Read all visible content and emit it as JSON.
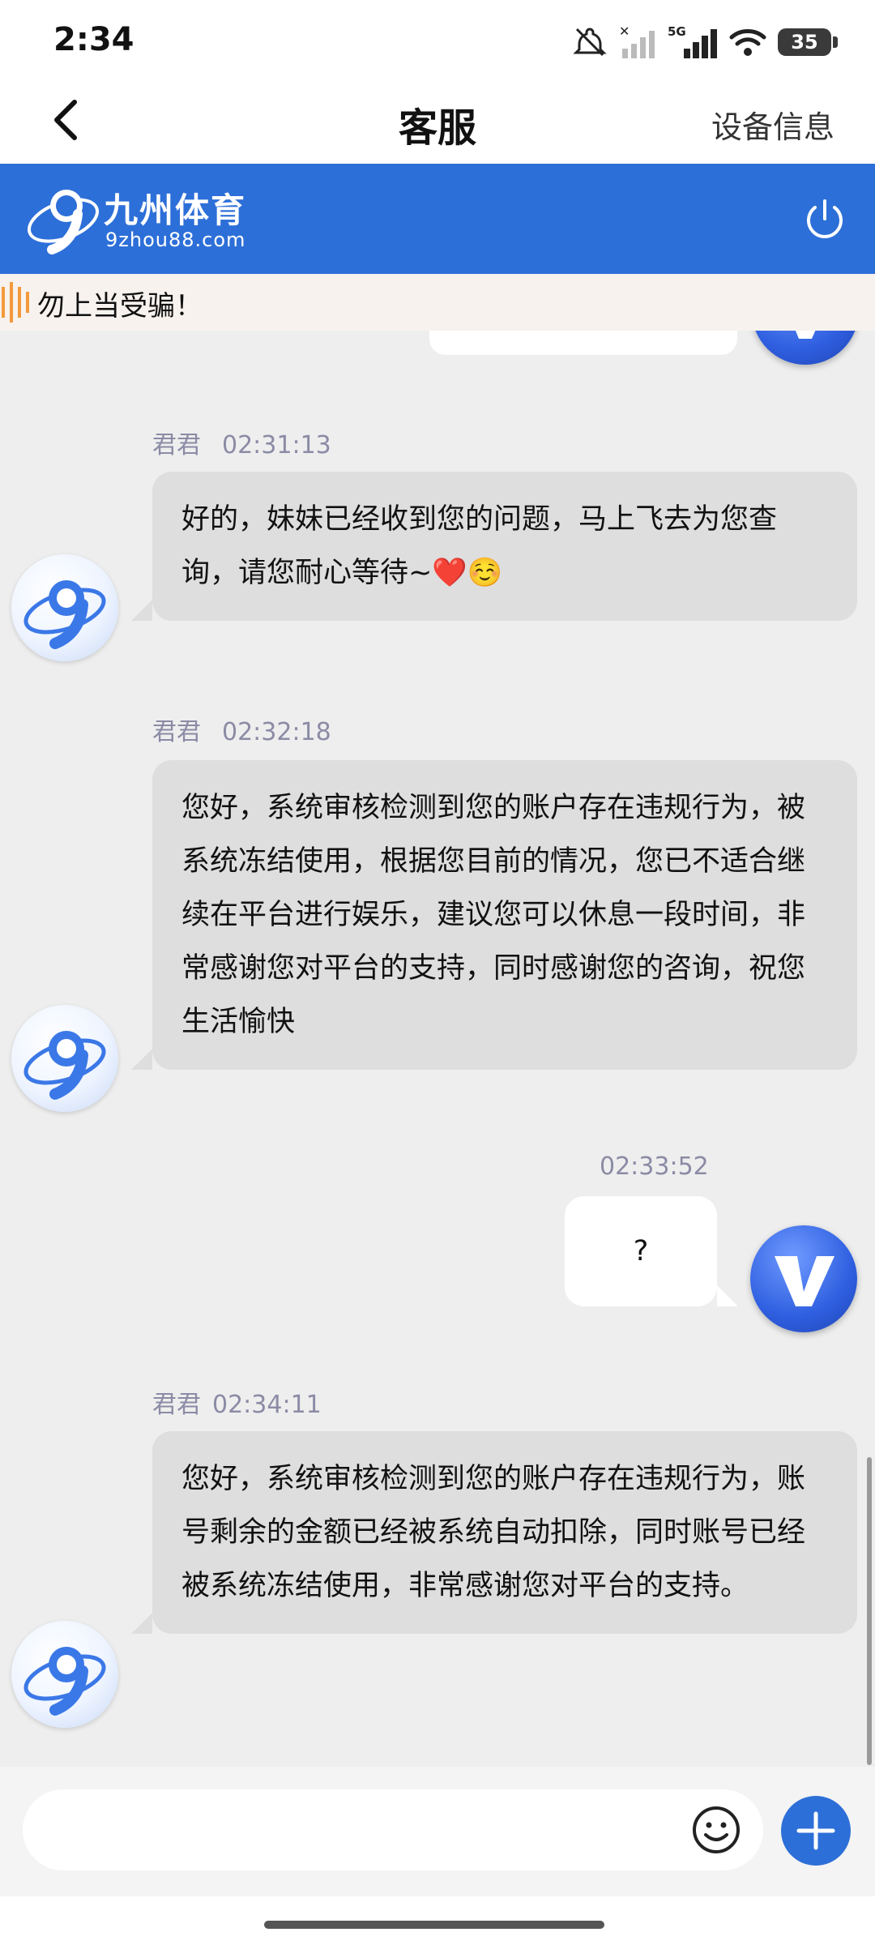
{
  "status_bar": {
    "time": "2:34",
    "network": "5G",
    "battery": "35"
  },
  "title_bar": {
    "title": "客服",
    "right_action": "设备信息"
  },
  "brand": {
    "name": "九州体育",
    "domain": "9zhou88.com",
    "color": "#2d6fd8"
  },
  "notice": {
    "text": "勿上当受骗！"
  },
  "messages": [
    {
      "sender": "君君",
      "time": "02:31:13",
      "text": "好的，妹妹已经收到您的问题，马上飞去为您查询，请您耐心等待~❤️☺️"
    },
    {
      "sender": "君君",
      "time": "02:32:18",
      "text": "您好，系统审核检测到您的账户存在违规行为，被系统冻结使用，根据您目前的情况，您已不适合继续在平台进行娱乐，建议您可以休息一段时间，非常感谢您对平台的支持，同时感谢您的咨询，祝您生活愉快"
    },
    {
      "sender": "",
      "time": "02:33:52",
      "text": "?"
    },
    {
      "sender": "君君",
      "time": "02:34:11",
      "text": "您好，系统审核检测到您的账户存在违规行为，账号剩余的金额已经被系统自动扣除，同时账号已经被系统冻结使用，非常感谢您对平台的支持。"
    }
  ],
  "input": {
    "value": "",
    "placeholder": ""
  }
}
